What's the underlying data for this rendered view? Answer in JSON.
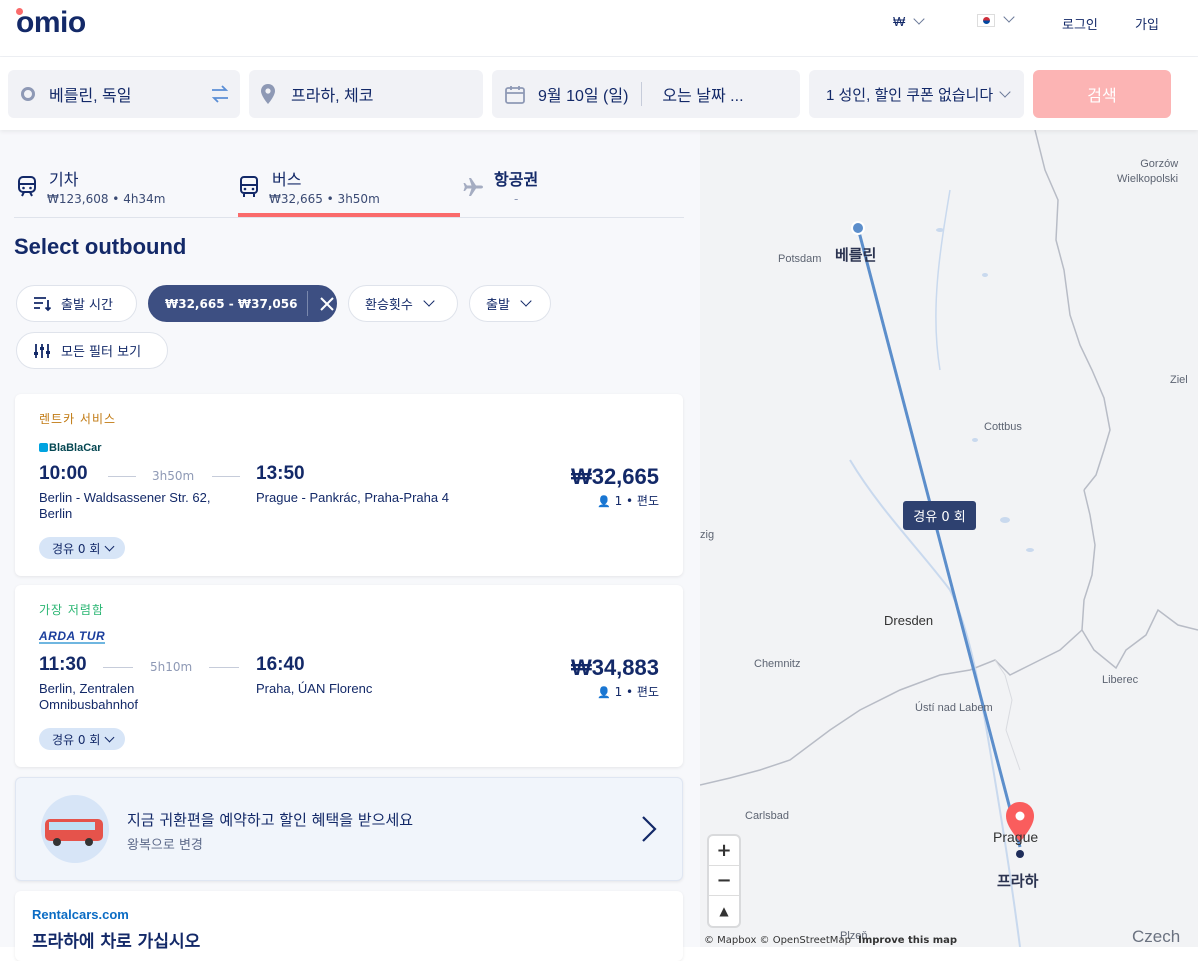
{
  "header": {
    "logo": "omio",
    "currency": "₩",
    "login": "로그인",
    "signup": "가입"
  },
  "search": {
    "origin": "베를린, 독일",
    "destination": "프라하, 체코",
    "depart_date": "9월 10일 (일)",
    "return_date": "오는 날짜 ...",
    "passengers": "1 성인, 할인 쿠폰 없습니다",
    "search_button": "검색"
  },
  "tabs": [
    {
      "label": "기차",
      "sub": "₩123,608 • 4h34m"
    },
    {
      "label": "버스",
      "sub": "₩32,665 • 3h50m"
    },
    {
      "label": "항공권",
      "sub": "-"
    }
  ],
  "page_title": "Select outbound",
  "filters": {
    "sort": "출발 시간",
    "price": "₩32,665 - ₩37,056",
    "transfers": "환승횟수",
    "departure": "출발",
    "all_filters": "모든 필터 보기"
  },
  "results": [
    {
      "tag": "렌트카 서비스",
      "tag_color": "#c17a13",
      "operator": "BlaBlaCar",
      "depart_time": "10:00",
      "duration": "3h50m",
      "arrive_time": "13:50",
      "from_station": "Berlin - Waldsassener Str. 62, Berlin",
      "to_station": "Prague - Pankrác, Praha-Praha 4",
      "price": "₩32,665",
      "passengers": "1 • 편도",
      "stops": "경유 0 회"
    },
    {
      "tag": "가장 저렴함",
      "tag_color": "#2bb673",
      "operator": "ARDA TUR",
      "depart_time": "11:30",
      "duration": "5h10m",
      "arrive_time": "16:40",
      "from_station": "Berlin, Zentralen Omnibusbahnhof",
      "to_station": "Praha, ÚAN Florenc",
      "price": "₩34,883",
      "passengers": "1 • 편도",
      "stops": "경유 0 회"
    }
  ],
  "promo": {
    "title": "지금 귀환편을 예약하고 할인 혜택을 받으세요",
    "subtitle": "왕복으로 변경"
  },
  "rentalcars": {
    "brand": "Rentalcars.com",
    "title": "프라하에 차로 가십시오"
  },
  "map": {
    "labels": {
      "gorzow": "Gorzów\nWielkopolski",
      "potsdam": "Potsdam",
      "berlin": "베를린",
      "ziel": "Ziel",
      "cottbus": "Cottbus",
      "leipzig_partial": "zig",
      "dresden": "Dresden",
      "chemnitz": "Chemnitz",
      "liberec": "Liberec",
      "usti": "Ústí nad Labem",
      "carlsbad": "Carlsbad",
      "prague": "Prague",
      "praha": "프라하",
      "plzen": "Plzeň",
      "czech": "Czech"
    },
    "route_badge": "경유 0 회",
    "attribution": "© Mapbox © OpenStreetMap",
    "improve": "Improve this map"
  }
}
